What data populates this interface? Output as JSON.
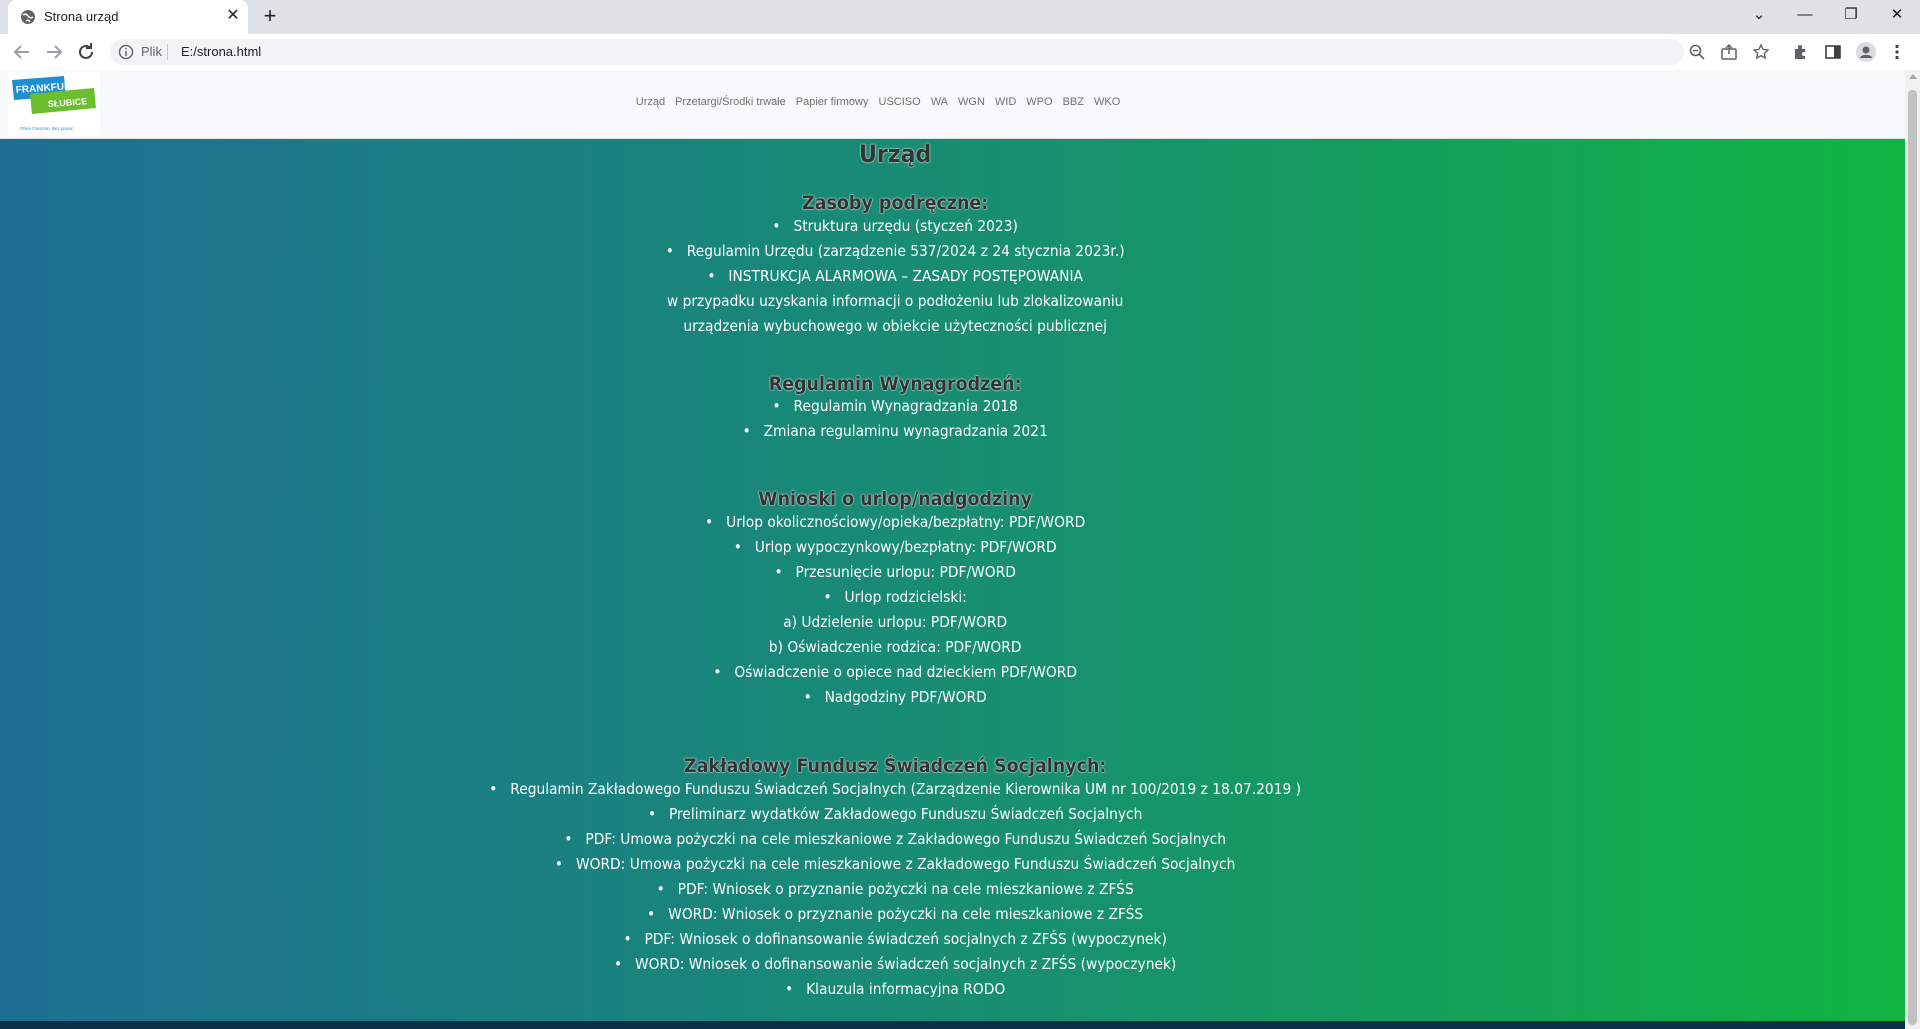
{
  "browser": {
    "tab_title": "Strona urząd",
    "tab_close": "✕",
    "new_tab": "+",
    "url_scheme": "Plik",
    "url": "E:/strona.html",
    "window_controls": [
      "⌄",
      "—",
      "❐",
      "✕"
    ],
    "icons": [
      "back-icon",
      "forward-icon",
      "reload-icon",
      "info-icon",
      "zoom-icon",
      "share-icon",
      "bookmark-star-icon",
      "extensions-icon",
      "side-panel-icon",
      "profile-icon",
      "menu-icon"
    ]
  },
  "nav": {
    "logo_text_top": "FRANKFURT",
    "logo_text_bottom": "SŁUBICE",
    "logo_tagline": "Ohne Grenzen. Bez granic.",
    "links": [
      "Urząd",
      "Przetargi/Środki trwałe",
      "Papier firmowy",
      "USCISO",
      "WA",
      "WGN",
      "WID",
      "WPO",
      "BBZ",
      "WKO"
    ]
  },
  "main": {
    "title": "Urząd",
    "sections": {
      "zasoby": {
        "heading": "Zasoby podręczne:",
        "items": [
          "Struktura urzędu (styczeń 2023)",
          "Regulamin Urzędu (zarządzenie 537/2024 z 24 stycznia 2023r.)",
          "INSTRUKCJA ALARMOWA – ZASADY POSTĘPOWANIA"
        ],
        "extra_lines": [
          "w przypadku uzyskania informacji o podłożeniu lub zlokalizowaniu",
          "urządzenia wybuchowego w obiekcie użyteczności publicznej"
        ]
      },
      "wynagrodzenia": {
        "heading": "Regulamin Wynagrodzeń:",
        "items": [
          "Regulamin Wynagradzania 2018",
          "Zmiana regulaminu wynagradzania 2021"
        ]
      },
      "wnioski": {
        "heading": "Wnioski o urlop/nadgodziny",
        "items": [
          "Urlop okolicznościowy/opieka/bezpłatny: PDF/WORD",
          "Urlop wypoczynkowy/bezpłatny: PDF/WORD",
          "Przesunięcie urlopu: PDF/WORD",
          "Urlop rodzicielski:"
        ],
        "sub_lines": [
          "a) Udzielenie urlopu: PDF/WORD",
          "b) Oświadczenie rodzica: PDF/WORD"
        ],
        "items_after": [
          "Oświadczenie o opiece nad dzieckiem PDF/WORD",
          "Nadgodziny PDF/WORD"
        ]
      },
      "zfss": {
        "heading": "Zakładowy Fundusz Świadczeń Socjalnych:",
        "items": [
          "Regulamin Zakładowego Funduszu Świadczeń Socjalnych (Zarządzenie Kierownika UM nr 100/2019 z 18.07.2019 )",
          "Preliminarz wydatków Zakładowego Funduszu Świadczeń Socjalnych",
          "PDF: Umowa pożyczki na cele mieszkaniowe z Zakładowego Funduszu Świadczeń Socjalnych",
          "WORD: Umowa pożyczki na cele mieszkaniowe z Zakładowego Funduszu Świadczeń Socjalnych",
          "PDF: Wniosek o przyznanie pożyczki na cele mieszkaniowe z ZFŚS",
          "WORD: Wniosek o przyznanie pożyczki na cele mieszkaniowe z ZFŚS",
          "PDF: Wniosek o dofinansowanie świadczeń socjalnych z ZFŚS (wypoczynek)",
          "WORD: Wniosek o dofinansowanie świadczeń socjalnych z ZFŚS (wypoczynek)",
          "Klauzula informacyjna RODO"
        ]
      }
    }
  },
  "colors": {
    "gradient_left": "#1d6f93",
    "gradient_right": "#10b441",
    "heading": "#333333",
    "body_text": "#ffffff"
  }
}
